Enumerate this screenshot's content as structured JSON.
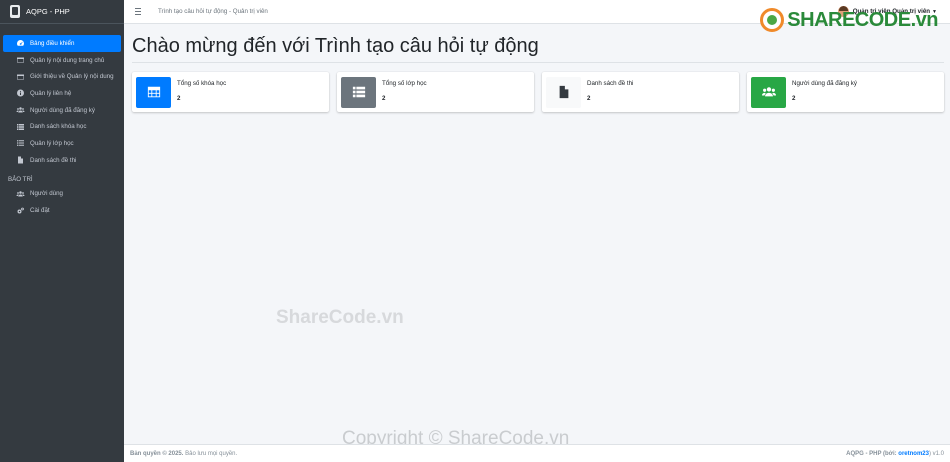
{
  "brand": {
    "title": "AQPG - PHP"
  },
  "sidebar": {
    "items": [
      {
        "label": "Bảng điều khiển",
        "icon": "dashboard-icon",
        "active": true
      },
      {
        "label": "Quản lý nội dung trang chủ",
        "icon": "window-icon"
      },
      {
        "label": "Giới thiệu về Quản lý nội dung",
        "icon": "window-icon"
      },
      {
        "label": "Quản lý liên hệ",
        "icon": "info-icon"
      },
      {
        "label": "Người dùng đã đăng ký",
        "icon": "users-icon"
      },
      {
        "label": "Danh sách khóa học",
        "icon": "list-icon"
      },
      {
        "label": "Quản lý lớp học",
        "icon": "list-ul-icon"
      },
      {
        "label": "Danh sách đề thi",
        "icon": "file-icon"
      }
    ],
    "section_header": "BẢO TRÌ",
    "maintenance": [
      {
        "label": "Người dùng",
        "icon": "users-icon"
      },
      {
        "label": "Cài đặt",
        "icon": "cogs-icon"
      }
    ]
  },
  "navbar": {
    "breadcrumb": "Trình tạo câu hỏi tự động - Quản trị viên",
    "user": "Quản trị viên Quản trị viên"
  },
  "main": {
    "title": "Chào mừng đến với Trình tạo câu hỏi tự động",
    "cards": [
      {
        "label": "Tổng số khóa học",
        "value": "2",
        "color": "#007bff",
        "icon": "table-icon"
      },
      {
        "label": "Tổng số lớp học",
        "value": "2",
        "color": "#6c757d",
        "icon": "list-icon"
      },
      {
        "label": "Danh sách đề thi",
        "value": "2",
        "color": "#f8f9fa",
        "icon": "file-icon"
      },
      {
        "label": "Người dùng đã đăng ký",
        "value": "2",
        "color": "#28a745",
        "icon": "users-icon"
      }
    ]
  },
  "footer": {
    "copyright_prefix": "Bản quyền © 2025.",
    "rights": "Bảo lưu mọi quyền.",
    "right_prefix": "AQPG - PHP (bởi:",
    "author": "oretnom23",
    "right_suffix": ") v1.0"
  },
  "watermark": {
    "logo_main": "SHARECODE",
    "logo_tld": ".vn",
    "center": "ShareCode.vn",
    "copyright": "Copyright © ShareCode.vn"
  }
}
